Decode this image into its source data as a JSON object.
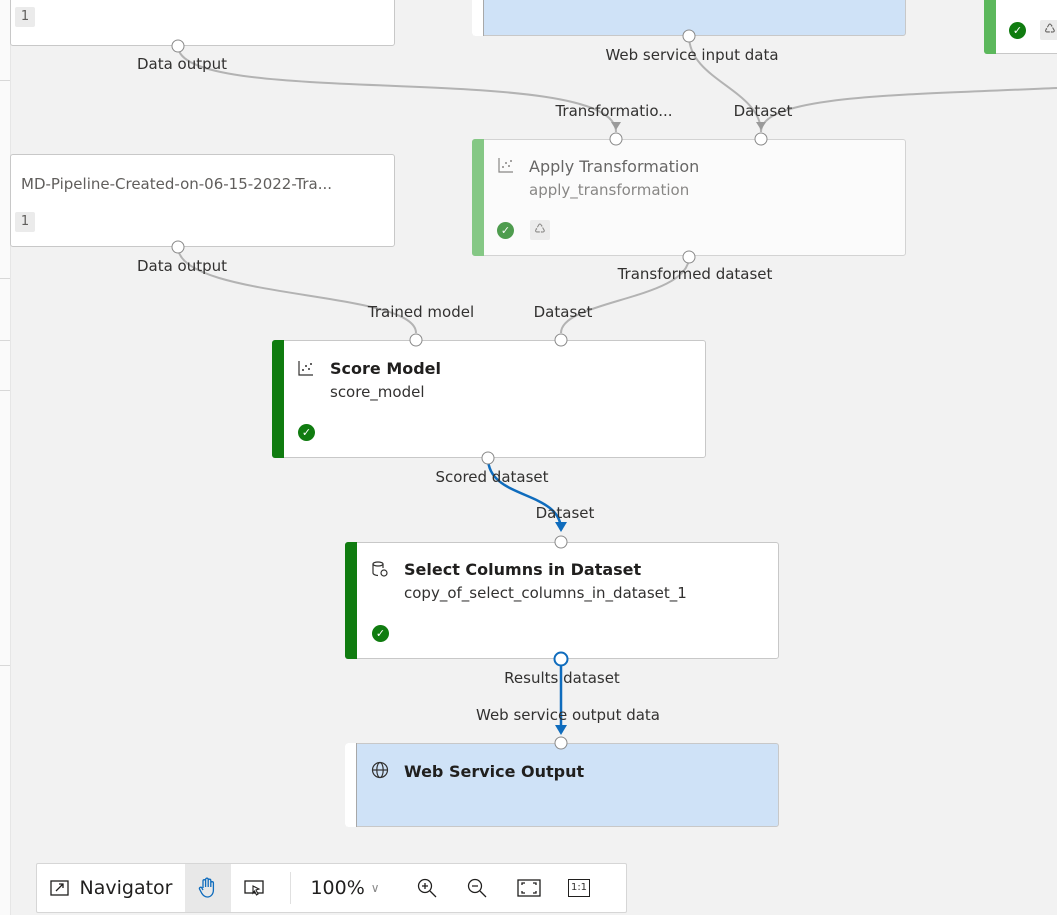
{
  "nodes": {
    "top_left": {
      "badge": "1"
    },
    "top_right": {},
    "apply_transformation": {
      "title": "Apply Transformation",
      "subtitle": "apply_transformation"
    },
    "md_pipeline": {
      "title": "MD-Pipeline-Created-on-06-15-2022-Tra...",
      "badge": "1"
    },
    "score_model": {
      "title": "Score Model",
      "subtitle": "score_model"
    },
    "select_columns": {
      "title": "Select Columns in Dataset",
      "subtitle": "copy_of_select_columns_in_dataset_1"
    },
    "web_service_output": {
      "title": "Web Service Output"
    }
  },
  "ports": {
    "data_output_1": "Data output",
    "web_service_input_data": "Web service input data",
    "transformation": "Transformatio...",
    "dataset_apply": "Dataset",
    "data_output_2": "Data output",
    "transformed_dataset": "Transformed dataset",
    "trained_model": "Trained model",
    "dataset_score": "Dataset",
    "scored_dataset": "Scored dataset",
    "dataset_select": "Dataset",
    "results_dataset": "Results dataset",
    "web_service_output_data": "Web service output data"
  },
  "toolbar": {
    "navigator": "Navigator",
    "zoom": "100%",
    "actual_size": "1:1"
  },
  "colors": {
    "completed": "#107c10",
    "selected_edge": "#0f6cbd",
    "edge": "#b3b3b3",
    "io_node": "#cfe2f7"
  },
  "icons": {
    "module": "scatter-icon",
    "dataset": "select-columns-icon",
    "web": "globe-icon",
    "status": "check-circle-icon",
    "reuse": "recycle-icon"
  }
}
